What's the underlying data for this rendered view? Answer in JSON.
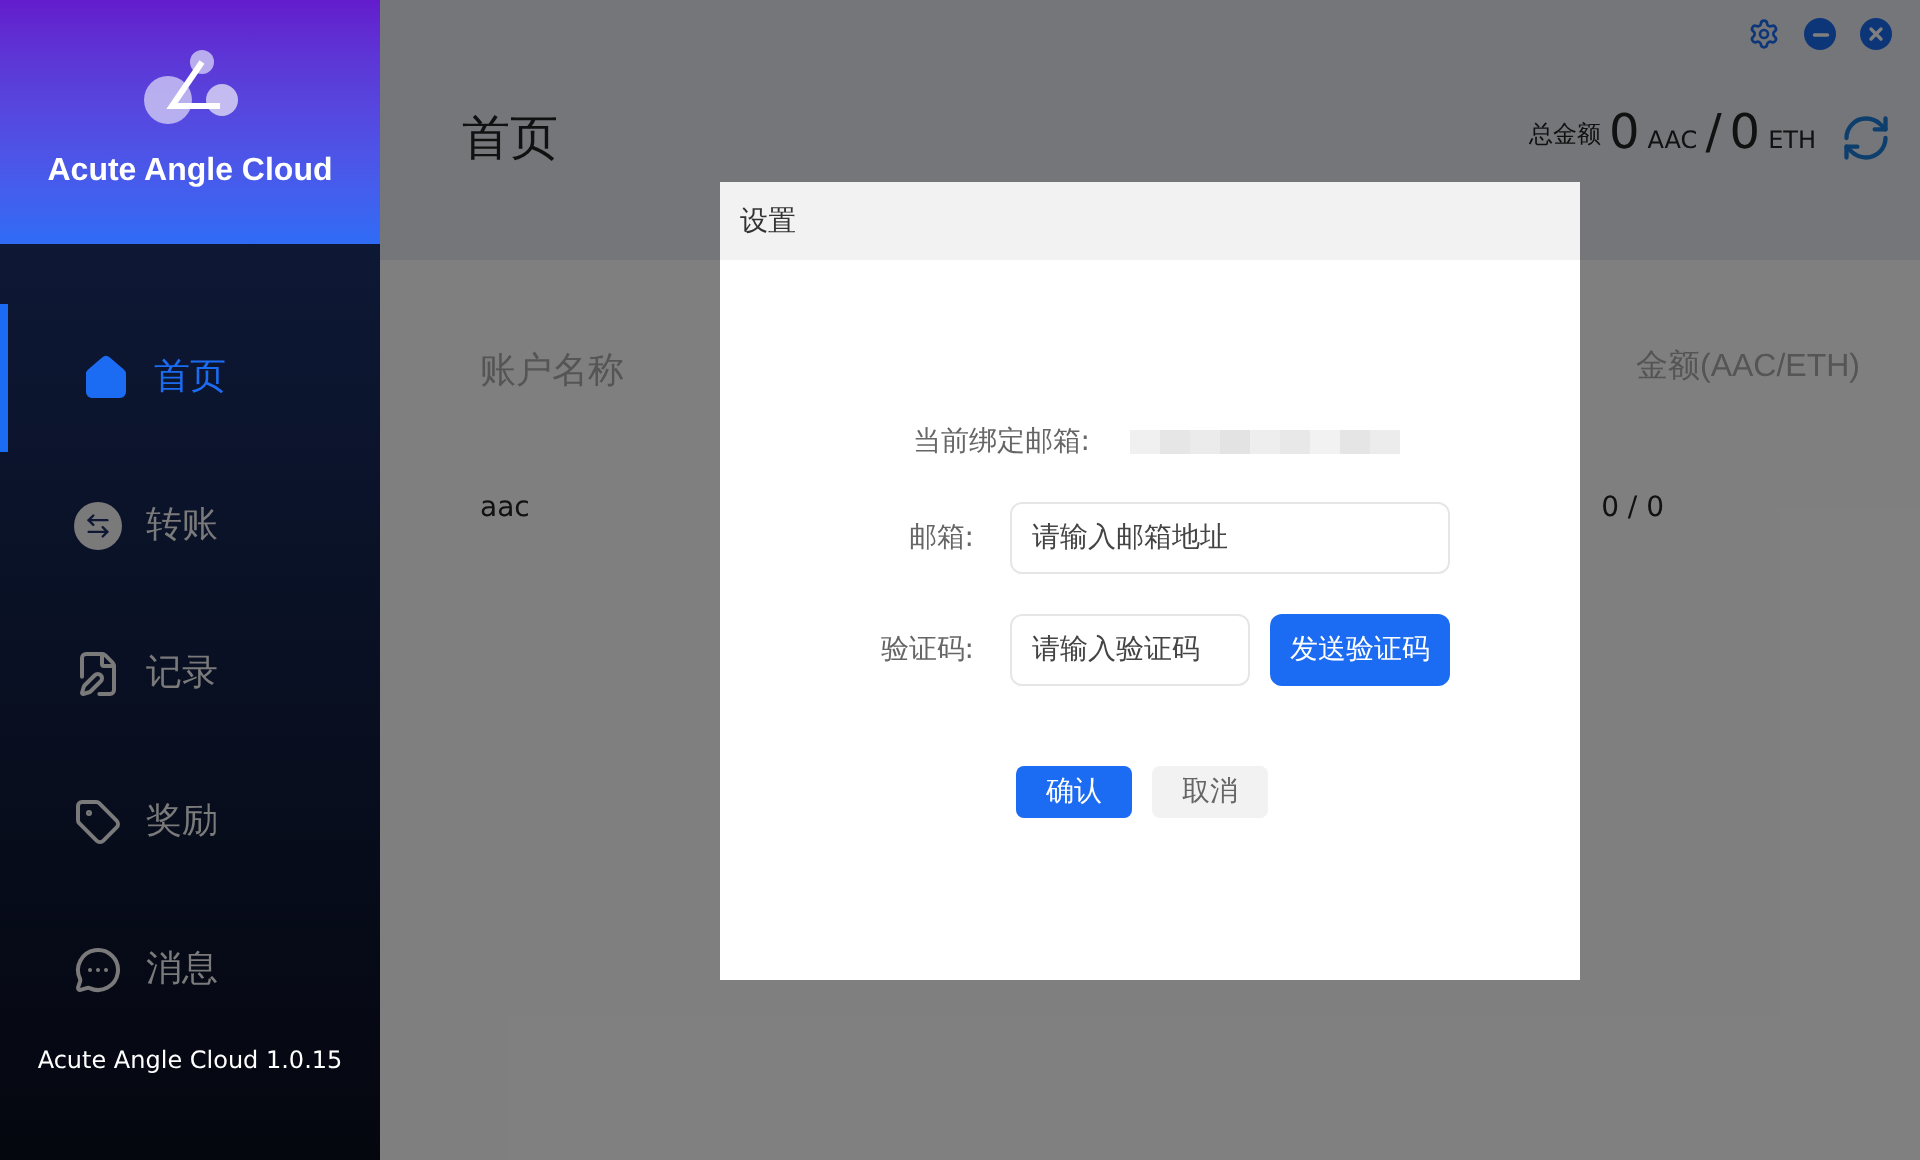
{
  "app": {
    "name": "Acute Angle Cloud",
    "version": "Acute Angle Cloud 1.0.15"
  },
  "nav": [
    {
      "label": "首页",
      "kind": "home",
      "selected": true
    },
    {
      "label": "转账",
      "kind": "transfer",
      "selected": false
    },
    {
      "label": "记录",
      "kind": "record",
      "selected": false
    },
    {
      "label": "奖励",
      "kind": "reward",
      "selected": false
    },
    {
      "label": "消息",
      "kind": "message",
      "selected": false
    }
  ],
  "page": {
    "title": "首页",
    "total_label": "总金额",
    "aac_value": "0",
    "aac_unit": "AAC",
    "separator": "/",
    "eth_value": "0",
    "eth_unit": "ETH"
  },
  "table": {
    "columns": [
      "账户名称",
      "金额(AAC/ETH)"
    ],
    "rows": [
      [
        "aac",
        "0 / 0"
      ]
    ]
  },
  "dialog": {
    "title": "设置",
    "current_email": {
      "label": "当前绑定邮箱:",
      "kind": "blurred"
    },
    "email": {
      "label": "邮箱:",
      "placeholder": "请输入邮箱地址"
    },
    "code": {
      "label": "验证码:",
      "placeholder": "请输入验证码",
      "send_button": "发送验证码"
    },
    "confirm": "确认",
    "cancel": "取消"
  }
}
